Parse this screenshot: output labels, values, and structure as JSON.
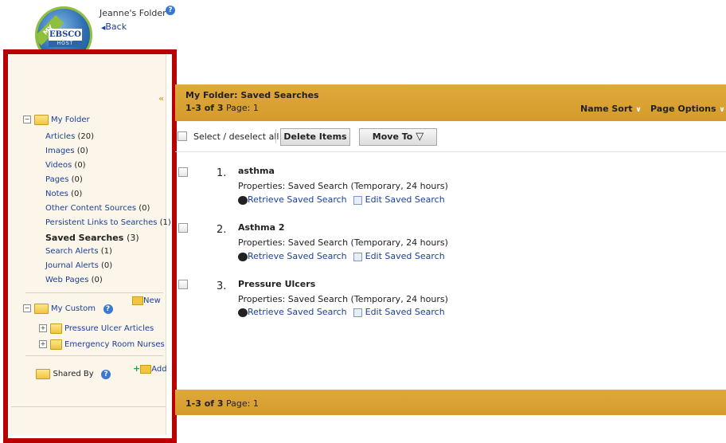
{
  "header": {
    "folder_title": "Jeanne's Folder",
    "back_label": "Back"
  },
  "logo": {
    "banner_text": "MY",
    "brand_text": "EBSCO",
    "sub_text": "HOST"
  },
  "sidebar": {
    "collapse_glyph": "«",
    "my_folder_label": "My Folder",
    "items": [
      {
        "label": "Articles",
        "count": "(20)"
      },
      {
        "label": "Images",
        "count": "(0)"
      },
      {
        "label": "Videos",
        "count": "(0)"
      },
      {
        "label": "Pages",
        "count": "(0)"
      },
      {
        "label": "Notes",
        "count": "(0)"
      },
      {
        "label": "Other Content Sources",
        "count": "(0)"
      },
      {
        "label": "Persistent Links to Searches",
        "count": "(1)"
      },
      {
        "label": "Saved Searches",
        "count": "(3)"
      },
      {
        "label": "Search Alerts",
        "count": "(1)"
      },
      {
        "label": "Journal Alerts",
        "count": "(0)"
      },
      {
        "label": "Web Pages",
        "count": "(0)"
      }
    ],
    "my_custom_label": "My Custom",
    "new_label": "New",
    "custom_folders": [
      "Pressure Ulcer Articles",
      "Emergency Room Nurses"
    ],
    "shared_by_label": "Shared By",
    "add_label": "Add"
  },
  "main": {
    "title": "My Folder: Saved Searches",
    "count_bold": "1-3 of 3",
    "page_label": "Page: 1",
    "name_sort_label": "Name Sort",
    "page_options_label": "Page Options",
    "select_all_label": "Select / deselect all",
    "delete_label": "Delete Items",
    "move_label": "Move To",
    "results": [
      {
        "num": "1.",
        "title": "asthma",
        "properties": "Properties: Saved Search (Temporary, 24 hours)",
        "retrieve": "Retrieve Saved Search",
        "edit": "Edit Saved Search"
      },
      {
        "num": "2.",
        "title": "Asthma 2",
        "properties": "Properties: Saved Search (Temporary, 24 hours)",
        "retrieve": "Retrieve Saved Search",
        "edit": "Edit Saved Search"
      },
      {
        "num": "3.",
        "title": "Pressure Ulcers",
        "properties": "Properties: Saved Search (Temporary, 24 hours)",
        "retrieve": "Retrieve Saved Search",
        "edit": "Edit Saved Search"
      }
    ],
    "footer_count_bold": "1-3 of 3",
    "footer_page_label": "Page: 1"
  },
  "colors": {
    "band": "#d9a133",
    "sidebar_bg": "#fbf5ea",
    "highlight_frame": "#b80000",
    "link": "#1a3f9c"
  },
  "icons": [
    "help-icon",
    "folder-icon",
    "tree-toggle-icon",
    "new-folder-icon",
    "add-folder-icon",
    "retrieve-icon",
    "edit-icon",
    "chevron-down-icon",
    "back-arrow-icon"
  ]
}
